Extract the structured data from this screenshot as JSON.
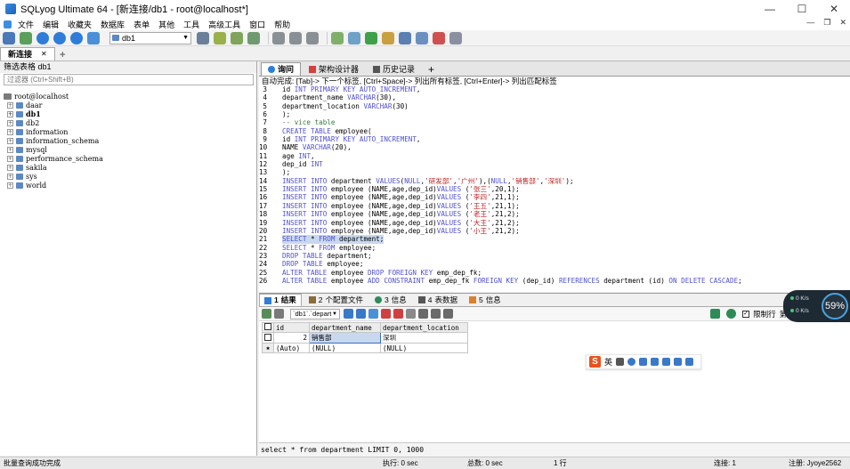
{
  "window": {
    "title": "SQLyog Ultimate 64 - [新连接/db1 - root@localhost*]",
    "controls": [
      "—",
      "☐",
      "✕"
    ]
  },
  "menu": {
    "items": [
      "文件",
      "编辑",
      "收藏夹",
      "数据库",
      "表单",
      "其他",
      "工具",
      "高级工具",
      "窗口",
      "帮助"
    ],
    "mdi_controls": [
      "—",
      "❐",
      "✕"
    ]
  },
  "toolbar": {
    "db_select": "db1"
  },
  "connection_tabs": {
    "active": "新连接",
    "close": "✕",
    "add": "+"
  },
  "left_panel": {
    "filter_label": "筛选表格 db1",
    "filter_placeholder": "过滤器 (Ctrl+Shift+B)",
    "root": "root@localhost",
    "databases": [
      "daar",
      "db1",
      "db2",
      "information",
      "information_schema",
      "mysql",
      "performance_schema",
      "sakila",
      "sys",
      "world"
    ]
  },
  "editor_tabs": {
    "query": "询问",
    "schema": "架构设计器",
    "history": "历史记录",
    "add": "+"
  },
  "editor": {
    "hint": "自动完成: [Tab]-> 下一个标签, [Ctrl+Space]-> 列出所有标签, [Ctrl+Enter]-> 列出匹配标签",
    "lines": [
      {
        "n": "3",
        "text": "id INT PRIMARY KEY AUTO_INCREMENT,"
      },
      {
        "n": "4",
        "text": "department_name VARCHAR(30),"
      },
      {
        "n": "5",
        "text": "department_location VARCHAR(30)"
      },
      {
        "n": "6",
        "text": ");"
      },
      {
        "n": "7",
        "text": "-- vice table"
      },
      {
        "n": "8",
        "text": "CREATE TABLE employee("
      },
      {
        "n": "9",
        "text": "id INT PRIMARY KEY AUTO_INCREMENT,"
      },
      {
        "n": "10",
        "text": "NAME VARCHAR(20),"
      },
      {
        "n": "11",
        "text": "age INT,"
      },
      {
        "n": "12",
        "text": "dep_id INT"
      },
      {
        "n": "13",
        "text": ");"
      },
      {
        "n": "14",
        "text": "INSERT INTO department VALUES(NULL,'研发部','广州'),(NULL,'销售部','深圳');"
      },
      {
        "n": "15",
        "text": "INSERT INTO employee (NAME,age,dep_id)VALUES ('张三',20,1);"
      },
      {
        "n": "16",
        "text": "INSERT INTO employee (NAME,age,dep_id)VALUES ('李四',21,1);"
      },
      {
        "n": "17",
        "text": "INSERT INTO employee (NAME,age,dep_id)VALUES ('王五',21,1);"
      },
      {
        "n": "18",
        "text": "INSERT INTO employee (NAME,age,dep_id)VALUES ('老王',21,2);"
      },
      {
        "n": "19",
        "text": "INSERT INTO employee (NAME,age,dep_id)VALUES ('大王',21,2);"
      },
      {
        "n": "20",
        "text": "INSERT INTO employee (NAME,age,dep_id)VALUES ('小王',21,2);"
      },
      {
        "n": "21",
        "text": "SELECT * FROM department;"
      },
      {
        "n": "22",
        "text": "SELECT * FROM employee;"
      },
      {
        "n": "23",
        "text": "DROP TABLE department;"
      },
      {
        "n": "24",
        "text": "DROP TABLE employee;"
      },
      {
        "n": "25",
        "text": "ALTER TABLE employee DROP FOREIGN KEY emp_dep_fk;"
      },
      {
        "n": "26",
        "text": "ALTER TABLE employee ADD CONSTRAINT emp_dep_fk FOREIGN KEY (dep_id) REFERENCES department (id) ON DELETE CASCADE;"
      }
    ],
    "highlighted_line": "21"
  },
  "result_tabs": [
    {
      "num": "1",
      "label": "结果"
    },
    {
      "num": "2",
      "label": "个配置文件"
    },
    {
      "num": "3",
      "label": "信息"
    },
    {
      "num": "4",
      "label": "表数据"
    },
    {
      "num": "5",
      "label": "信息"
    }
  ],
  "result_toolbar": {
    "table_select": "`db1`.`depart",
    "limit_label": "限制行",
    "first_row_label": "第一行：",
    "first_row_value": "0"
  },
  "grid": {
    "columns": [
      "id",
      "department_name",
      "department_location"
    ],
    "rows": [
      {
        "id": "2",
        "department_name": "销售部",
        "department_location": "深圳"
      },
      {
        "id": "(Auto)",
        "department_name": "(NULL)",
        "department_location": "(NULL)"
      }
    ]
  },
  "ime": {
    "logo": "S",
    "mode": "英"
  },
  "perf": {
    "up": "0 K/s",
    "down": "0 K/s",
    "percent": "59%"
  },
  "sql_status": "select * from department LIMIT 0, 1000",
  "status": {
    "left": "批量查询成功完成",
    "exec": "执行: 0 sec",
    "total": "总数: 0 sec",
    "rows": "1 行",
    "connections": "连接: 1",
    "registered": "注册: Jyoye2562"
  }
}
